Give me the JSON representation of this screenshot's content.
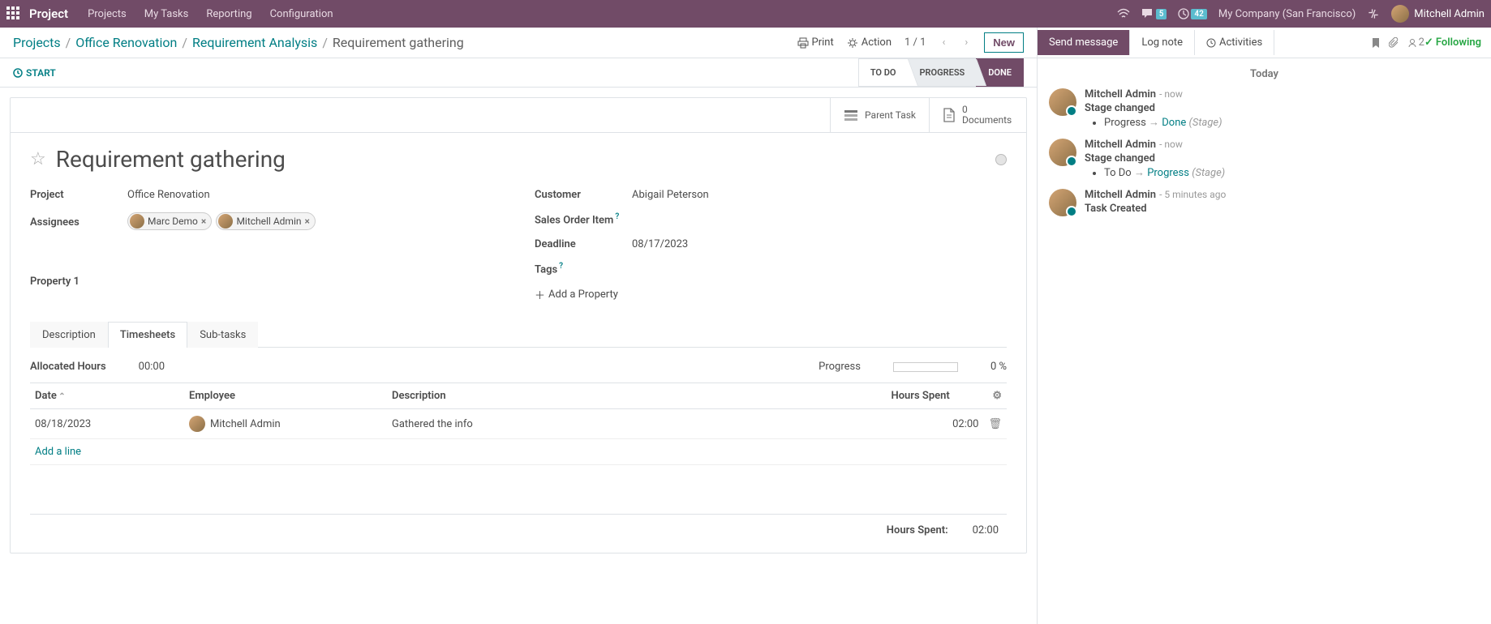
{
  "topbar": {
    "brand": "Project",
    "menu": [
      "Projects",
      "My Tasks",
      "Reporting",
      "Configuration"
    ],
    "messages_badge": "5",
    "activities_badge": "42",
    "company": "My Company (San Francisco)",
    "user": "Mitchell Admin"
  },
  "breadcrumb": {
    "items": [
      "Projects",
      "Office Renovation",
      "Requirement Analysis"
    ],
    "current": "Requirement gathering",
    "print": "Print",
    "action": "Action",
    "pager": "1 / 1",
    "new_btn": "New"
  },
  "statusbar": {
    "start": "START",
    "stages": [
      "TO DO",
      "PROGRESS",
      "DONE"
    ],
    "active_stage": 2
  },
  "stats": {
    "parent": "Parent Task",
    "documents_count": "0",
    "documents_label": "Documents"
  },
  "task": {
    "title": "Requirement gathering",
    "fields": {
      "project_label": "Project",
      "project_value": "Office Renovation",
      "assignees_label": "Assignees",
      "assignees": [
        "Marc Demo",
        "Mitchell Admin"
      ],
      "customer_label": "Customer",
      "customer_value": "Abigail Peterson",
      "sales_order_label": "Sales Order Item",
      "deadline_label": "Deadline",
      "deadline_value": "08/17/2023",
      "tags_label": "Tags",
      "property1_label": "Property 1",
      "add_property": "Add a Property"
    }
  },
  "tabs": [
    "Description",
    "Timesheets",
    "Sub-tasks"
  ],
  "active_tab": 1,
  "timesheets": {
    "allocated_label": "Allocated Hours",
    "allocated_value": "00:00",
    "progress_label": "Progress",
    "progress_value": "0 %",
    "columns": {
      "date": "Date",
      "employee": "Employee",
      "description": "Description",
      "hours": "Hours Spent"
    },
    "rows": [
      {
        "date": "08/18/2023",
        "employee": "Mitchell Admin",
        "description": "Gathered the info",
        "hours": "02:00"
      }
    ],
    "add_line": "Add a line",
    "total_label": "Hours Spent:",
    "total_value": "02:00"
  },
  "chatter": {
    "send": "Send message",
    "log": "Log note",
    "activities": "Activities",
    "follower_count": "2",
    "following": "Following",
    "today": "Today",
    "messages": [
      {
        "author": "Mitchell Admin",
        "time": "now",
        "title": "Stage changed",
        "track_from": "Progress",
        "track_to": "Done",
        "track_type": "(Stage)"
      },
      {
        "author": "Mitchell Admin",
        "time": "now",
        "title": "Stage changed",
        "track_from": "To Do",
        "track_to": "Progress",
        "track_type": "(Stage)"
      },
      {
        "author": "Mitchell Admin",
        "time": "5 minutes ago",
        "title": "Task Created"
      }
    ]
  }
}
